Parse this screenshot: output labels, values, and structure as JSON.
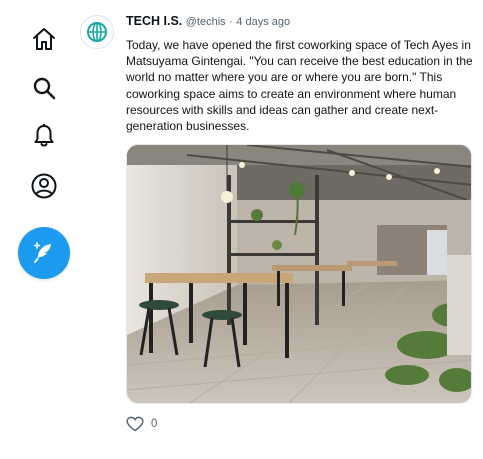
{
  "nav": {
    "items": [
      {
        "name": "home",
        "icon": "home-icon"
      },
      {
        "name": "search",
        "icon": "search-icon"
      },
      {
        "name": "notifications",
        "icon": "bell-icon"
      },
      {
        "name": "profile",
        "icon": "profile-icon"
      }
    ],
    "compose_icon": "feather-icon",
    "accent_color": "#1d9bf0"
  },
  "post": {
    "author_name": "TECH I.S.",
    "handle": "@techis",
    "separator": "·",
    "time": "4 days ago",
    "text": "Today, we have opened the first coworking space of Tech Ayes in Matsuyama Gintengai. \"You can receive the best education in the world no matter where you are or where you are born.\" This coworking space aims to create an environment where human resources with skills and ideas can gather and create next-generation businesses.",
    "avatar_icon": "globe-logo-icon",
    "media_description": "coworking-space-photo",
    "like_count": "0"
  }
}
